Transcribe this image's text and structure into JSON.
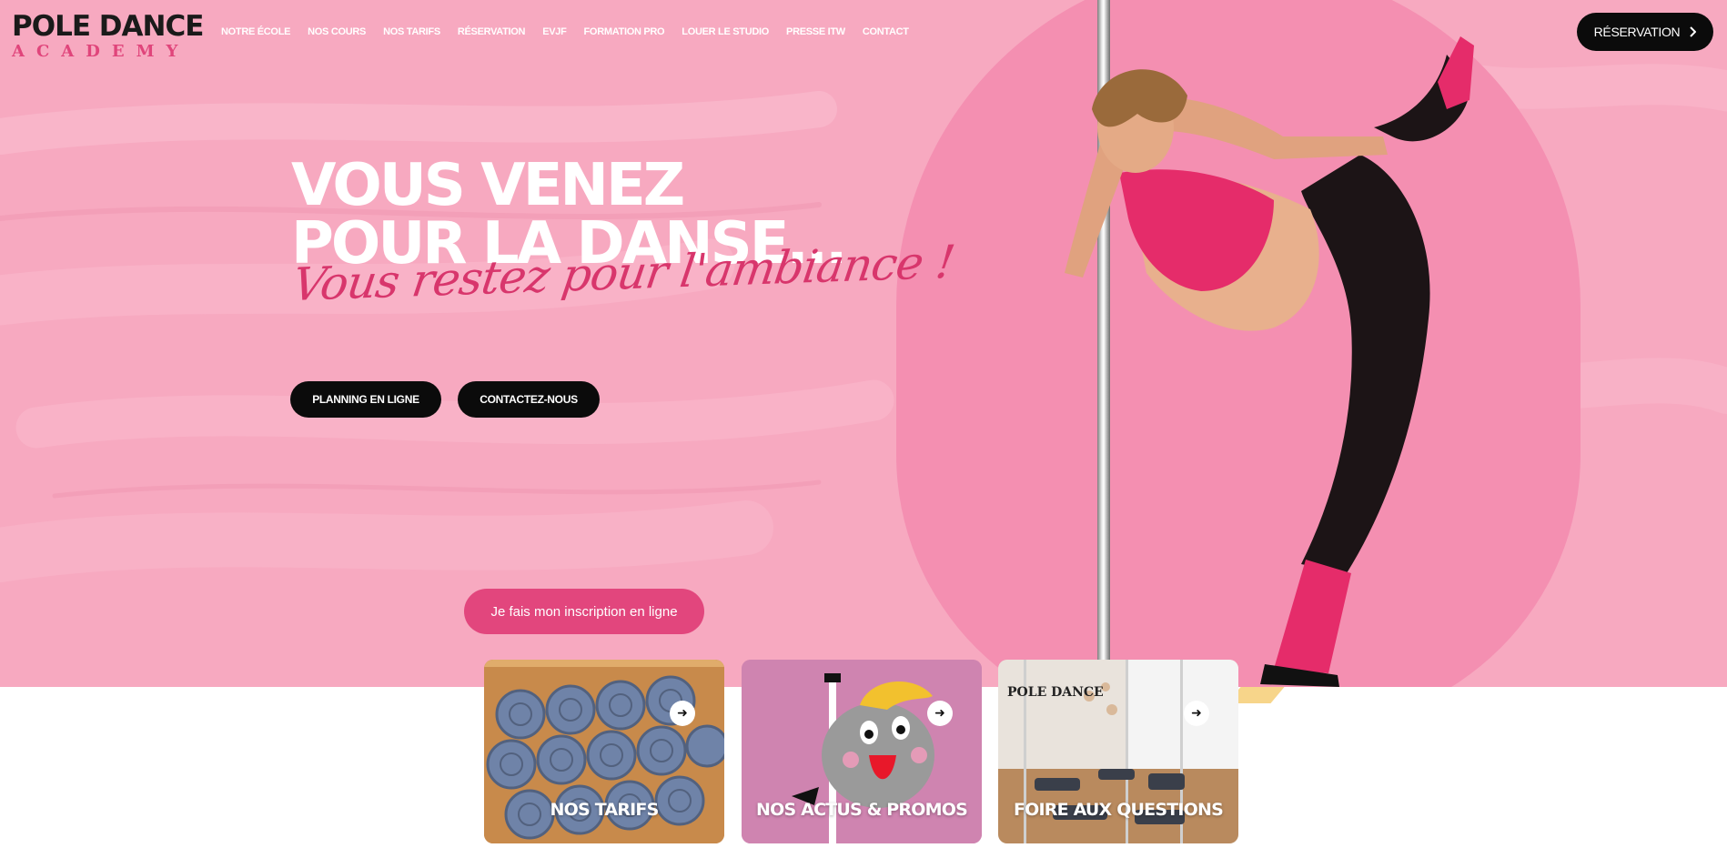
{
  "logo": {
    "top": "POLE DANCE",
    "bottom": "ACADEMY"
  },
  "nav": {
    "items": [
      {
        "label": "Notre école"
      },
      {
        "label": "Nos cours"
      },
      {
        "label": "Nos tarifs"
      },
      {
        "label": "Réservation"
      },
      {
        "label": "EVJF"
      },
      {
        "label": "Formation Pro"
      },
      {
        "label": "Louer le studio"
      },
      {
        "label": "Presse ITW"
      },
      {
        "label": "Contact"
      }
    ],
    "cta_label": "Réservation",
    "cta_icon": "chevron-right-icon"
  },
  "hero": {
    "headline_line1": "VOUS VENEZ",
    "headline_line2": "POUR LA DANSE...",
    "script": "Vous restez pour l'ambiance !",
    "btn_planning": "PLANNING EN LIGNE",
    "btn_contact": "CONTACTEZ-NOUS",
    "btn_signup": "Je fais mon inscription en ligne"
  },
  "cards": [
    {
      "label": "NOS TARIFS",
      "icon": "arrow-right-icon"
    },
    {
      "label": "NOS ACTUS & PROMOS",
      "icon": "arrow-right-icon"
    },
    {
      "label": "FOIRE AUX QUESTIONS",
      "icon": "arrow-right-icon"
    }
  ],
  "colors": {
    "hero_bg": "#f7a9c0",
    "blob": "#f48fb1",
    "accent_pink": "#e2467d",
    "script_pink": "#d8366c",
    "dark": "#0b0b0b"
  }
}
